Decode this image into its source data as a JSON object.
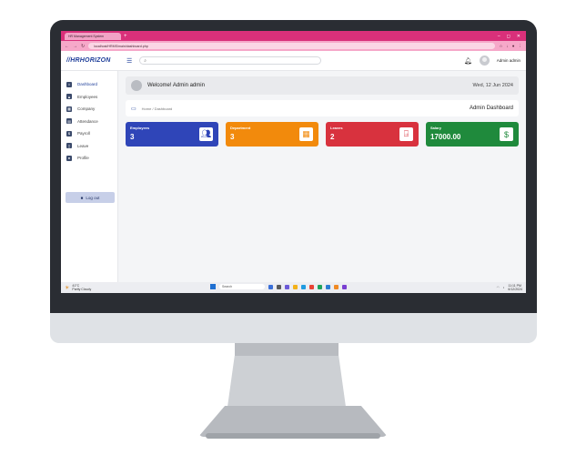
{
  "browser": {
    "tab_title": "HR Management System",
    "url": "localhost/HRMS/main/dashboard.php",
    "tab_add": "+",
    "controls": [
      "–",
      "◻",
      "✕"
    ]
  },
  "header": {
    "logo": "HRHORIZON",
    "search_placeholder": "",
    "admin_name": "Admin admin"
  },
  "sidebar": {
    "items": [
      {
        "label": "Dashboard",
        "icon": "home-icon"
      },
      {
        "label": "Employees",
        "icon": "users-icon"
      },
      {
        "label": "Company",
        "icon": "building-icon"
      },
      {
        "label": "Attendance",
        "icon": "calendar-icon"
      },
      {
        "label": "Payroll",
        "icon": "money-icon"
      },
      {
        "label": "Leave",
        "icon": "door-icon"
      },
      {
        "label": "Profile",
        "icon": "person-icon"
      }
    ],
    "logout_label": "Log out"
  },
  "welcome": {
    "text": "Welcome! Admin admin",
    "date": "Wed, 12 Jun 2024"
  },
  "breadcrumb": {
    "path": "Home / Dashboard",
    "title": "Admin Dashboard"
  },
  "cards": [
    {
      "label": "Employees",
      "value": "3",
      "color": "#2f45b8",
      "icon": "employees-icon"
    },
    {
      "label": "Department",
      "value": "3",
      "color": "#f28a0c",
      "icon": "department-icon"
    },
    {
      "label": "Leaves",
      "value": "2",
      "color": "#d8323e",
      "icon": "leave-icon"
    },
    {
      "label": "Salary",
      "value": "17000.00",
      "color": "#1f8a3c",
      "icon": "salary-icon"
    }
  ],
  "taskbar": {
    "weather_temp": "41°C",
    "weather_desc": "Partly Cloudy",
    "search_label": "Search",
    "time": "11:11 PM",
    "date": "6/12/2024"
  }
}
